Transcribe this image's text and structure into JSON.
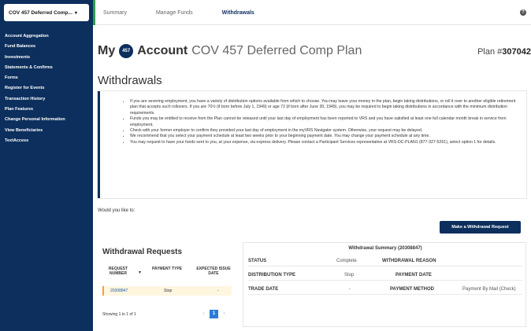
{
  "plan_selector": {
    "label": "COV 457 Deferred Comp..."
  },
  "tabs": [
    {
      "label": "Summary"
    },
    {
      "label": "Manage Funds"
    },
    {
      "label": "Withdrawals"
    }
  ],
  "help_icon": "question-circle-icon",
  "sidebar": {
    "items": [
      {
        "label": "Account Aggregation"
      },
      {
        "label": "Fund Balances"
      },
      {
        "label": "Investments"
      },
      {
        "label": "Statements & Confirms"
      },
      {
        "label": "Forms"
      },
      {
        "label": "Register for Events"
      },
      {
        "label": "Transaction History"
      },
      {
        "label": "Plan Features"
      },
      {
        "label": "Change Personal Information"
      },
      {
        "label": "View Beneficiaries"
      },
      {
        "label": "TextAccess"
      }
    ]
  },
  "header": {
    "my": "My",
    "badge": "457",
    "account": "Account",
    "plan_name": "COV 457 Deferred Comp Plan",
    "plan_number_label": "Plan #",
    "plan_number": "307042"
  },
  "page_title": "Withdrawals",
  "info_bullets": [
    "If you are severing employment, you have a variety of distribution options available from which to choose. You may leave your money in the plan, begin taking distributions, or roll it over to another eligible retirement plan that accepts such rollovers. If you are 70½ (if born before July 1, 1949) or age 72 (if born after June 30, 1949), you may be required to begin taking distributions in accordance with the minimum distribution requirements.",
    "Funds you may be entitled to receive from the Plan cannot be released until your last day of employment has been reported to VRS and you have satisfied at least one full calendar month break in service from employment.",
    "Check with your former employer to confirm they provided your last day of employment in the myVRS Navigator system. Otherwise, your request may be delayed.",
    "We recommend that you select your payment schedule at least two weeks prior to your beginning payment date. You may change your payment schedule at any time.",
    "You may request to have your funds sent to you, at your expense, via express delivery. Please contact a Participant Services representative at VRS-DC-PLAN1 (877-327-5261), select option 1 for details."
  ],
  "would_you_like": "Would you like to:",
  "make_request_button": "Make a Withdrawal Request",
  "withdrawal_requests": {
    "title": "Withdrawal Requests",
    "columns": [
      "REQUEST NUMBER",
      "PAYMENT TYPE",
      "EXPECTED ISSUE DATE"
    ],
    "rows": [
      {
        "request_number": "20308847",
        "payment_type": "Stop",
        "expected_issue_date": "-"
      }
    ],
    "showing": "Showing 1 to 1 of 1",
    "pager": {
      "prev": "‹",
      "current": "1",
      "next": "›"
    }
  },
  "summary": {
    "title": "Withdrawal Summary (20308847)",
    "rows": [
      {
        "k1": "STATUS",
        "v1": "Complete",
        "k2": "WITHDRAWAL REASON",
        "v2": ""
      },
      {
        "k1": "DISTRIBUTION TYPE",
        "v1": "Stop",
        "k2": "PAYMENT DATE",
        "v2": ""
      },
      {
        "k1": "TRADE DATE",
        "v1": "-",
        "k2": "PAYMENT METHOD",
        "v2": "Payment By Mail (Check)"
      }
    ]
  },
  "colors": {
    "navy": "#0c2f5d",
    "accent_green": "#2e9e4a",
    "row_highlight": "#f2a23a",
    "pager_blue": "#2a7cd6"
  }
}
